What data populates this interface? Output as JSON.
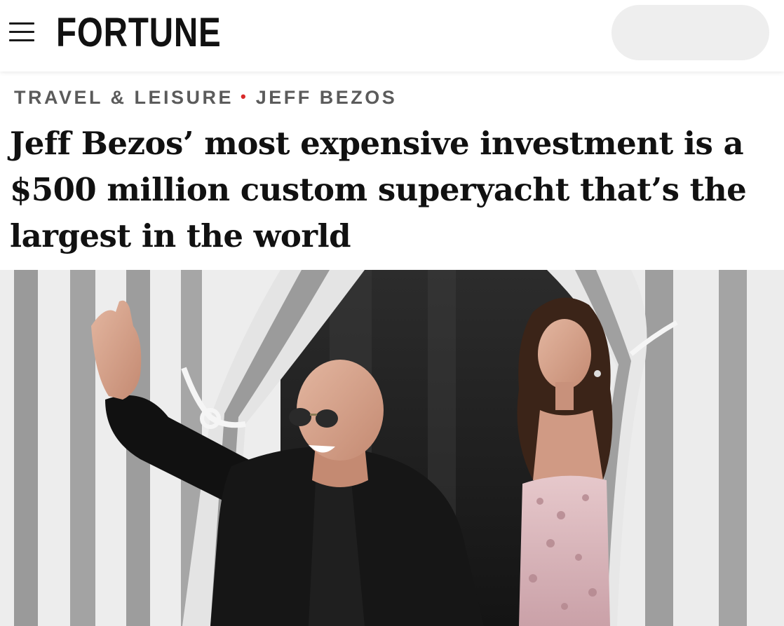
{
  "header": {
    "menu_icon": "hamburger-menu-icon",
    "logo_text": "FORTUNE",
    "search_pill": ""
  },
  "article": {
    "kicker": {
      "section": "TRAVEL & LEISURE",
      "separator": "•",
      "topic": "JEFF BEZOS"
    },
    "headline": "Jeff Bezos’ most expensive investment is a $500 million custom superyacht that’s the largest in the world",
    "hero_image": "photo-man-waving-woman-behind-striped-curtains"
  },
  "colors": {
    "separator_dot": "#d92a2a",
    "kicker_text": "#5b5b5b",
    "headline_text": "#111111"
  }
}
